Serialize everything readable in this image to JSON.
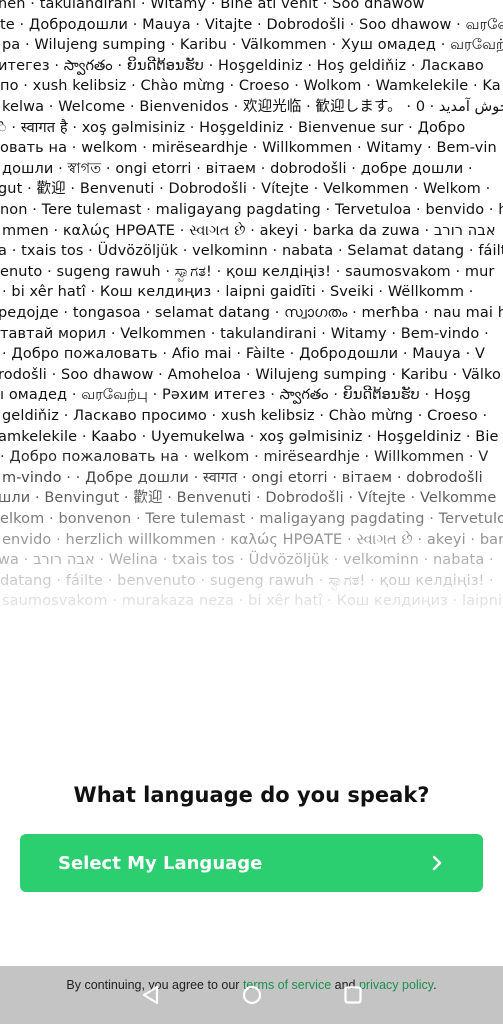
{
  "welcome_wall": [
    "nen · takulandirani · Witamy · Bine ati venit · Soo dhawow",
    "te · Добродошли · Mauya · Vitajte · Dobrodošli · Soo dhawow · வரவேற்பு",
    "pa · Wilujeng sumping · Karibu · Välkommen · Хуш омадед · வரவேற்பு",
    "итегез · స్వాగతం · ຍິນດີຕ້ອນຮັບ · Hoşgeldiniz · Hoş geldiňiz · Ласкаво",
    "по · xush kelibsiz · Chào mừng · Croeso · Wolkom · Wamkelekile · Ka",
    "kelwa · Welcome · Bienvenidos · 欢迎光临 · 歓迎します。 · خوش آمدید · 0",
    "ॆ · स्वागत है · xoş gəlmisiniz · Hoşgeldiniz · Bienvenue sur · Добро",
    "овать на · welkom · mirëseardhje · Willkommen · Witamy · Bem-vin",
    "дошли · স্বাগত · ongi etorri · вітаем · dobrodošli · добре дошли ·",
    "gut · 歡迎 · Benvenuti · Dobrodošli · Vítejte · Velkommen · Welkom ·",
    "non · Tere tulemast · maligayang pagdating · Tervetuloa · benvido · h",
    "mmen · καλώς ΗΡΘΑΤΕ · સ્વાગત છે · akeyi · barka da zuwa · אבה רורב",
    "a · txais tos · Üdvözöljük · velkominn · nabata · Selamat datang · fáilte",
    "enuto · sugeng rawuh · ಸ್ವಾಗತ! · қош келдіңіз! · saumosvakom · mur",
    "· bi xêr hatî · Кош келдиңиз · laipni gaidīti · Sveiki · Wëllkomm ·",
    "редојде · tongasoa · selamat datang · സ്വാഗതം · merħba · nau mai h",
    "тавтай морил · Velkommen · takulandirani · Witamy · Bem-vindo ·",
    "· Добро пожаловать · Afio mai · Fàilte · Добродошли · Mauya · V",
    "rodošli · Soo dhawow · Amoheloa · Wilujeng sumping · Karibu · Välko",
    "ı омадед · வரவேற்பு · Рәхим итегез · స్వాగతం · ຍິນດີຕ້ອນຮັບ · Hoşg",
    "geldiňiz · Ласкаво просимо · xush kelibsiz · Chào mừng · Croeso ·",
    "amkelekile · Kaabo · Uyemukelwa · xoş gəlmisiniz · Hoşgeldiniz · Bie",
    "· Добро пожаловать на · welkom · mirëseardhje · Willkommen · V",
    "m-vindo · · Добре дошли · स्वागत · ongi etorri · вітаем · dobrodošli",
    "шли · Benvingut · 歡迎 · Benvenuti · Dobrodošli · Vítejte · Velkomme",
    "elkom · bonvenon · Tere tulemast · maligayang pagdating · Tervetulo",
    "envido · herzlich willkommen · καλώς ΗΡΘΑΤΕ · સ્વાગત છે · akeyi · bar",
    "wa · אבה רורב · Welina · txais tos · Üdvözöljük · velkominn · nabata ·",
    "datang · fáilte · benvenuto · sugeng rawuh · ಸ್ವಾಗತ! · қош келдіңіз! ·",
    "saumosvakom · murakaza neza · bi xêr hatî · Кош келдиңиз · laipni g"
  ],
  "question": "What language do you speak?",
  "select_button": {
    "label": "Select My Language"
  },
  "footer": {
    "prefix": "By continuing, you agree to our ",
    "terms_link": "terms of service",
    "middle": " and ",
    "privacy_link": "privacy policy",
    "suffix": "."
  },
  "nav_bar": {
    "back_icon": "back-triangle-icon",
    "home_icon": "home-circle-icon",
    "recents_icon": "recents-square-icon"
  },
  "colors": {
    "accent": "#2ccf6f",
    "link": "#1e8f4e",
    "nav_bar": "#c4c4c4"
  }
}
